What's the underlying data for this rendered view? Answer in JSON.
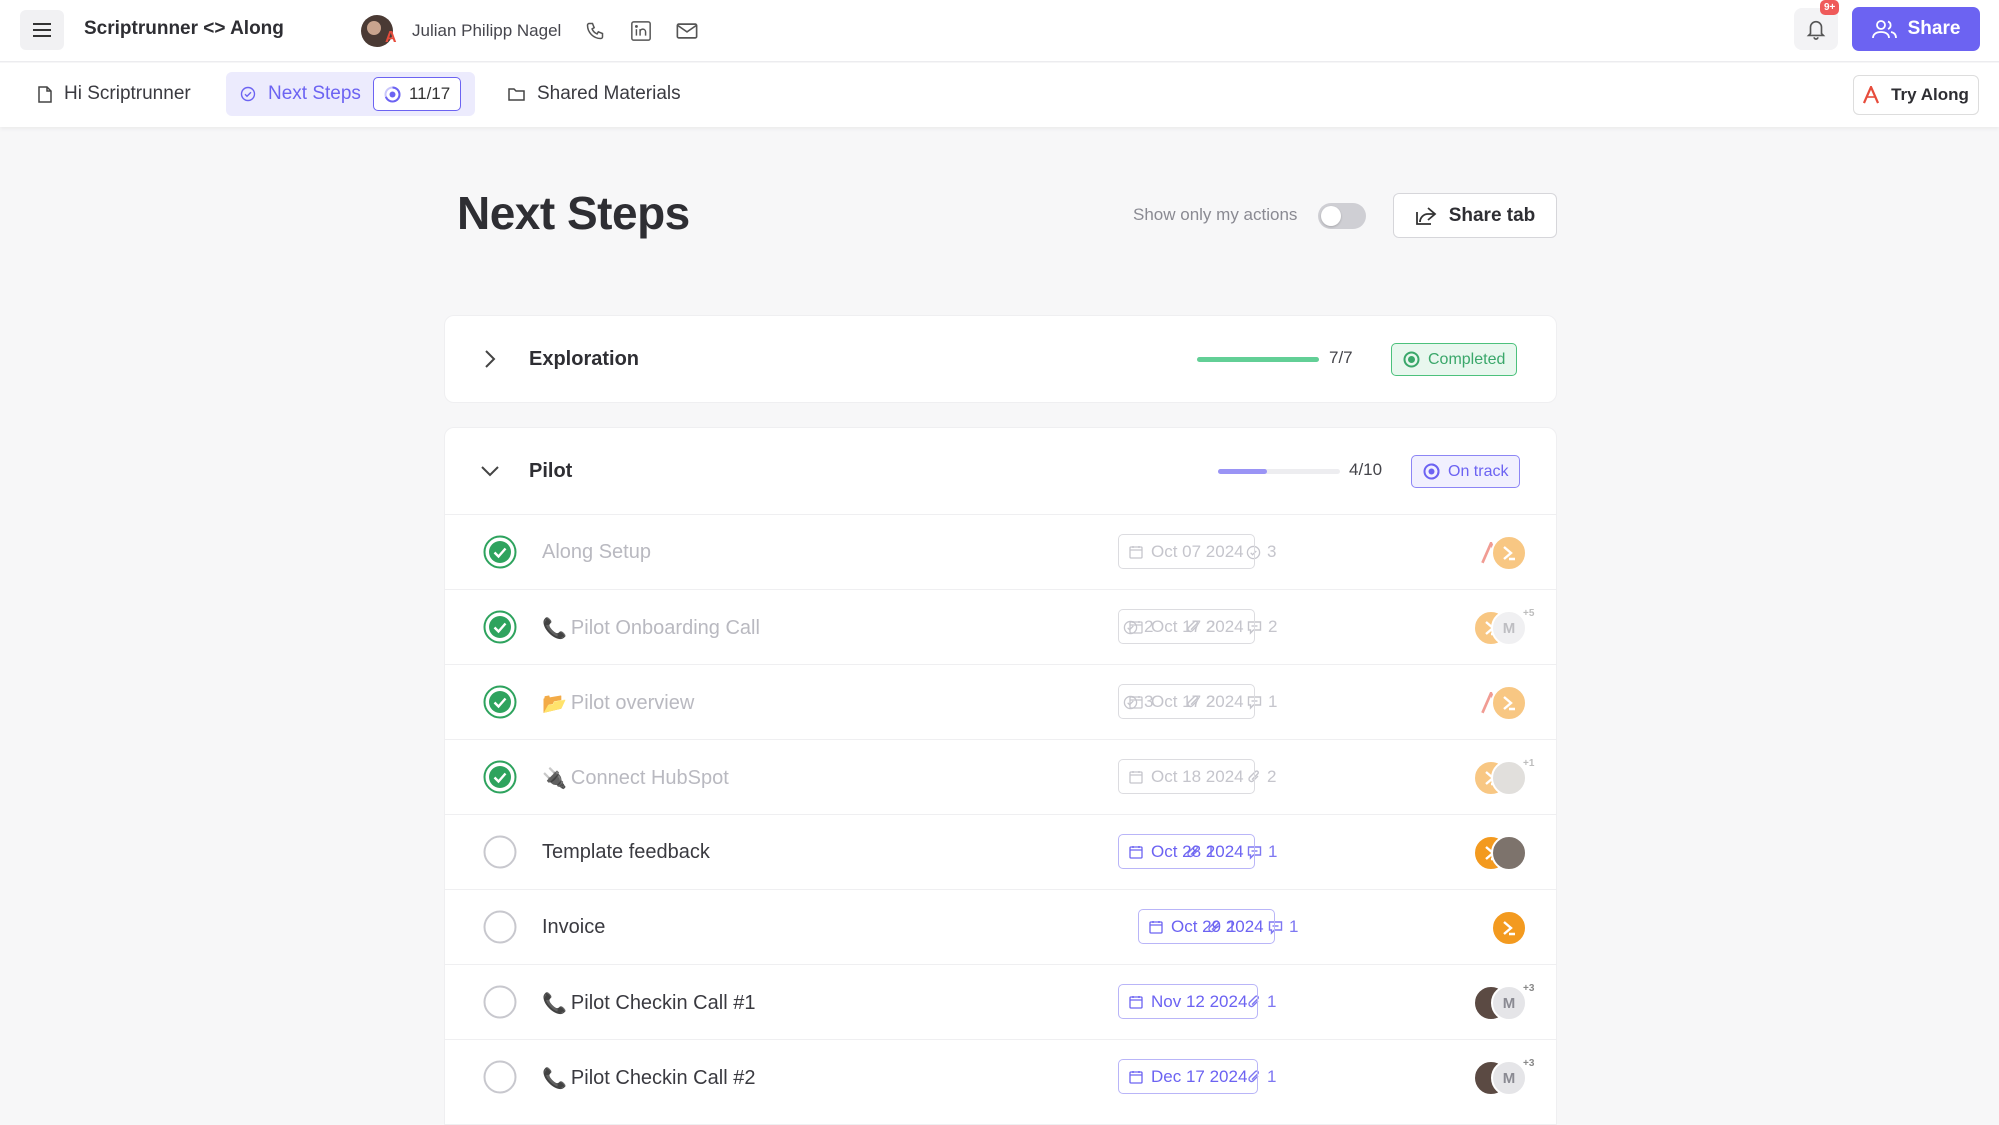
{
  "header": {
    "app_title": "Scriptrunner <> Along",
    "contact_name": "Julian Philipp Nagel",
    "notification_badge": "9+",
    "share_label": "Share"
  },
  "tabs": [
    {
      "label": "Hi Scriptrunner",
      "icon": "document-icon"
    },
    {
      "label": "Next Steps",
      "icon": "check-circle-icon",
      "count": "11/17"
    },
    {
      "label": "Shared Materials",
      "icon": "folder-icon"
    }
  ],
  "try_along_label": "Try Along",
  "page": {
    "title": "Next Steps",
    "toggle_label": "Show only my actions",
    "toggle_on": false,
    "share_tab_label": "Share tab"
  },
  "phases": [
    {
      "title": "Exploration",
      "expanded": false,
      "progress": "7/7",
      "progress_fraction": 1.0,
      "status": "Completed",
      "status_color": "#3aa76a"
    },
    {
      "title": "Pilot",
      "expanded": true,
      "progress": "4/10",
      "progress_fraction": 0.4,
      "status": "On track",
      "status_color": "#6c63f2"
    }
  ],
  "tasks": [
    {
      "emoji": "",
      "name": "Along Setup",
      "done": true,
      "checks": "3",
      "attachments": "",
      "comments": "",
      "date": "Oct 07 2024",
      "avatars": [
        "along",
        "scriptrunner"
      ]
    },
    {
      "emoji": "📞",
      "name": "Pilot Onboarding Call",
      "done": true,
      "checks": "2",
      "attachments": "2",
      "comments": "2",
      "date": "Oct 17 2024",
      "avatars": [
        "scriptrunner",
        "M"
      ],
      "more": "+5"
    },
    {
      "emoji": "📂",
      "name": "Pilot overview",
      "done": true,
      "checks": "3",
      "attachments": "2",
      "comments": "1",
      "date": "Oct 17 2024",
      "avatars": [
        "along",
        "scriptrunner"
      ]
    },
    {
      "emoji": "🔌",
      "name": "Connect HubSpot",
      "done": true,
      "checks": "",
      "attachments": "2",
      "comments": "",
      "date": "Oct 18 2024",
      "avatars": [
        "scriptrunner",
        "photo"
      ],
      "more": "+1"
    },
    {
      "emoji": "",
      "name": "Template feedback",
      "done": false,
      "checks": "",
      "attachments": "1",
      "comments": "1",
      "date": "Oct 28 2024",
      "avatars": [
        "scriptrunner",
        "photo"
      ]
    },
    {
      "emoji": "",
      "name": "Invoice",
      "done": false,
      "checks": "",
      "attachments": "1",
      "comments": "1",
      "date": "Oct 29 2024",
      "avatars": [
        "scriptrunner"
      ]
    },
    {
      "emoji": "📞",
      "name": "Pilot Checkin Call #1",
      "done": false,
      "checks": "",
      "attachments": "1",
      "comments": "",
      "date": "Nov 12 2024",
      "avatars": [
        "person",
        "M"
      ],
      "more": "+3"
    },
    {
      "emoji": "📞",
      "name": "Pilot Checkin Call #2",
      "done": false,
      "checks": "",
      "attachments": "1",
      "comments": "",
      "date": "Dec 17 2024",
      "avatars": [
        "person",
        "M"
      ],
      "more": "+3"
    }
  ],
  "colors": {
    "accent": "#6c63f2",
    "success": "#3aa76a",
    "scriptrunner": "#f39a1f"
  }
}
